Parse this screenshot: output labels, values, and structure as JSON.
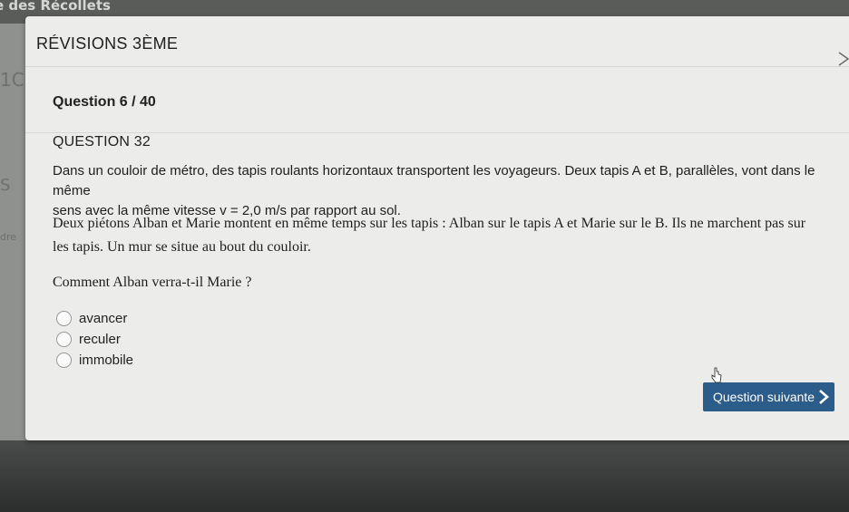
{
  "backdrop": {
    "title_fragment": "e des Récollets",
    "side_fragments": [
      "1C",
      "S",
      "dre"
    ]
  },
  "modal": {
    "title": "RÉVISIONS 3ÈME",
    "close_icon": "close-icon"
  },
  "question": {
    "counter": "Question 6 / 40",
    "number": "QUESTION 32",
    "paragraph1_line1": "Dans un couloir de métro, des tapis roulants horizontaux transportent les voyageurs. Deux tapis A et B, parallèles, vont dans le même",
    "paragraph1_line2": "sens avec la même vitesse v = 2,0 m/s par rapport au sol.",
    "paragraph2_line1": "Deux piétons Alban et Marie montent en même temps sur les tapis : Alban sur le tapis A et Marie sur le B. Ils ne marchent pas sur",
    "paragraph2_line2": "les tapis. Un mur se situe au bout du couloir.",
    "prompt": "Comment Alban verra-t-il Marie ?",
    "options": [
      "avancer",
      "reculer",
      "immobile"
    ]
  },
  "actions": {
    "next_label": "Question suivante",
    "next_icon": "chevron-right-icon"
  },
  "colors": {
    "button_bg": "#2b5c8a",
    "modal_bg": "#ececea",
    "backdrop": "#3c3e3d"
  }
}
